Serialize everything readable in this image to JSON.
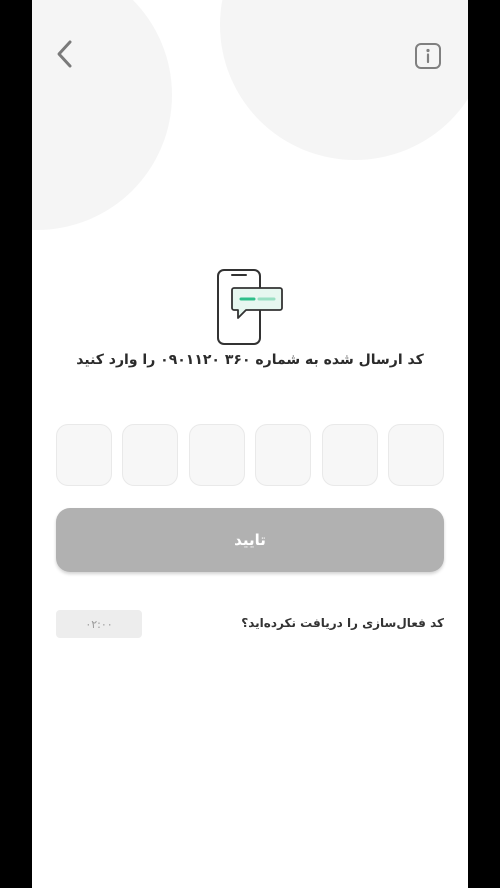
{
  "header": {
    "back_icon": "chevron-left-icon",
    "info_icon": "info-icon"
  },
  "illustration": {
    "icon": "phone-sms-icon",
    "accent_color": "#2fbf8a"
  },
  "instruction": {
    "text": "کد ارسال شده به شماره ۳۶۰ ۰۹۰۱۱۲۰ را وارد کنید"
  },
  "otp": {
    "digits": [
      "",
      "",
      "",
      "",
      "",
      ""
    ]
  },
  "confirm": {
    "label": "تایید",
    "disabled_color": "#b1b1b1"
  },
  "resend": {
    "question": "کد فعال‌سازی را دریافت نکرده‌اید؟",
    "timer": "۰۲:۰۰"
  }
}
